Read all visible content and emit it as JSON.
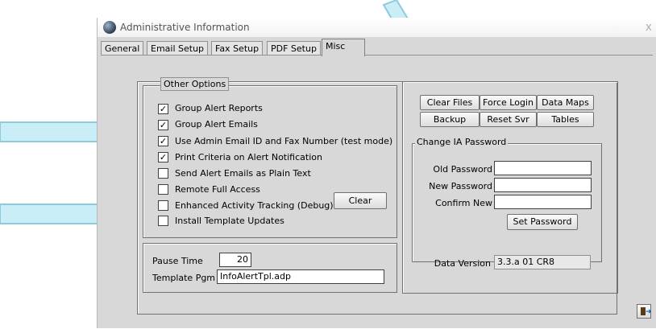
{
  "window": {
    "title": "Administrative Information",
    "close_glyph": "x"
  },
  "tabs": [
    {
      "label": "General"
    },
    {
      "label": "Email Setup"
    },
    {
      "label": "Fax Setup"
    },
    {
      "label": "PDF Setup"
    },
    {
      "label": "Misc"
    }
  ],
  "other_options": {
    "legend": "Other Options",
    "items": [
      {
        "label": "Group Alert Reports",
        "checked": true
      },
      {
        "label": "Group Alert Emails",
        "checked": true
      },
      {
        "label": "Use Admin Email ID and Fax Number (test mode)",
        "checked": true
      },
      {
        "label": "Print Criteria on Alert Notification",
        "checked": true
      },
      {
        "label": "Send Alert Emails as Plain Text",
        "checked": false
      },
      {
        "label": "Remote Full Access",
        "checked": false
      },
      {
        "label": "Enhanced Activity Tracking (Debug)",
        "checked": false
      },
      {
        "label": "Install Template Updates",
        "checked": false
      }
    ],
    "clear_button": "Clear"
  },
  "pause": {
    "pause_time_label": "Pause Time",
    "pause_time_value": "20",
    "template_pgm_label": "Template Pgm",
    "template_pgm_value": "InfoAlertTpl.adp"
  },
  "tools": {
    "buttons": [
      "Clear Files",
      "Force Login",
      "Data Maps",
      "Backup",
      "Reset Svr",
      "Tables"
    ]
  },
  "password": {
    "legend": "Change IA Password",
    "old_label": "Old Password",
    "new_label": "New Password",
    "confirm_label": "Confirm New",
    "set_button": "Set Password"
  },
  "version": {
    "label": "Data Version",
    "value": "3.3.a 01 CR8"
  },
  "check_glyph": "✓",
  "icons": {
    "app": "globe-app-icon",
    "exit": "exit-door-icon"
  },
  "colors": {
    "arrow_fill": "#c9eef7",
    "arrow_stroke": "#8fc9dc"
  }
}
